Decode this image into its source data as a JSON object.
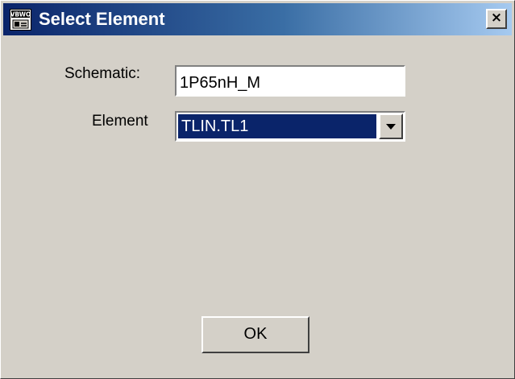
{
  "window": {
    "title": "Select Element",
    "close_label": "×",
    "icon": "app-window-icon"
  },
  "form": {
    "schematic_label": "Schematic:",
    "schematic_value": "1P65nH_M",
    "element_label": "Element",
    "element_value": "TLIN.TL1",
    "dropdown_icon": "chevron-down-icon"
  },
  "buttons": {
    "ok_label": "OK"
  },
  "colors": {
    "titlebar_start": "#0a246a",
    "titlebar_end": "#a6caf0",
    "selection": "#0a246a",
    "face": "#d4d0c8"
  }
}
